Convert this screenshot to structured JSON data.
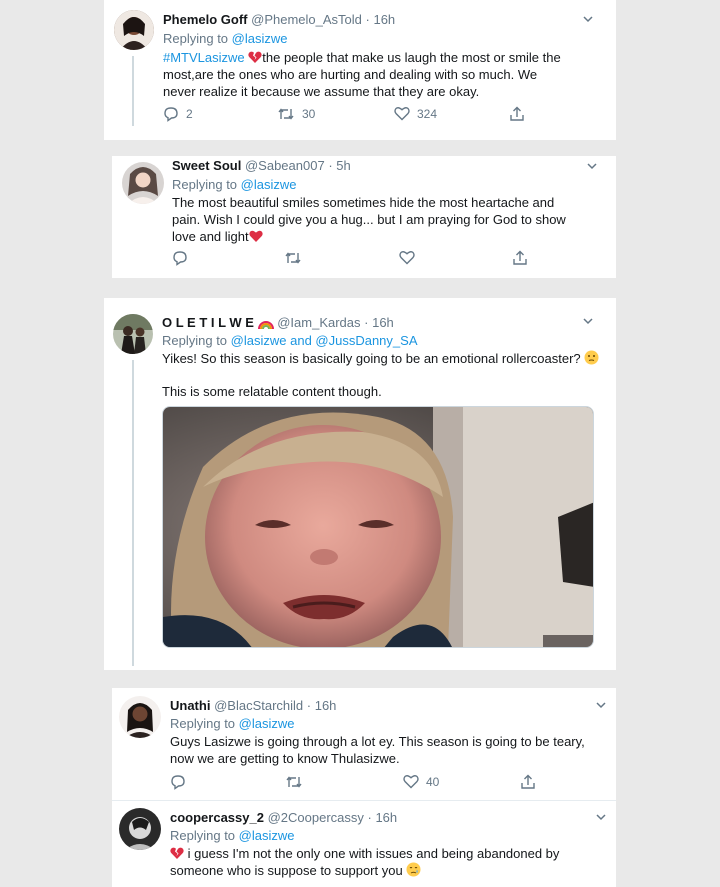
{
  "tweets": [
    {
      "name": "Phemelo Goff",
      "handle": "@Phemelo_AsTold",
      "time": "· 16h",
      "replying_prefix": "Replying to",
      "replying_to": "@lasizwe",
      "hashtag": "#MTVLasizwe",
      "text": "the people that make us laugh the most or smile the most,are the ones who are hurting and dealing with so much. We never realize it because we assume that they are okay.",
      "replies": "2",
      "retweets": "30",
      "likes": "324"
    },
    {
      "name": "Sweet Soul",
      "handle": "@Sabean007",
      "time": "· 5h",
      "replying_prefix": "Replying to",
      "replying_to": "@lasizwe",
      "text": "The most beautiful smiles sometimes hide the most heartache and pain. Wish I could give you a hug... but I am praying for God to show love and light",
      "replies": "",
      "retweets": "",
      "likes": ""
    },
    {
      "name": "O L E T I L W E",
      "handle": "@Iam_Kardas",
      "time": "· 16h",
      "replying_prefix": "Replying to",
      "replying_to": "@lasizwe and @JussDanny_SA",
      "text_line1": "Yikes! So this season is basically going to be an emotional rollercoaster?",
      "text_line2": "This is some relatable content though."
    },
    {
      "name": "Unathi",
      "handle": "@BlacStarchild",
      "time": "· 16h",
      "replying_prefix": "Replying to",
      "replying_to": "@lasizwe",
      "text": "Guys Lasizwe is going through a lot ey. This season is going to be teary, now we are getting to know Thulasizwe.",
      "replies": "",
      "retweets": "",
      "likes": "40"
    },
    {
      "name": "coopercassy_2",
      "handle": "@2Coopercassy",
      "time": "· 16h",
      "replying_prefix": "Replying to",
      "replying_to": "@lasizwe",
      "text_line1": "i guess  I'm not the  only one  with  issues and being abandoned by",
      "text_line2": "someone  who is  suppose  to  support  you"
    }
  ],
  "colors": {
    "link": "#1b95e0",
    "muted": "#657786",
    "text": "#14171a",
    "heart": "#e0245e"
  }
}
